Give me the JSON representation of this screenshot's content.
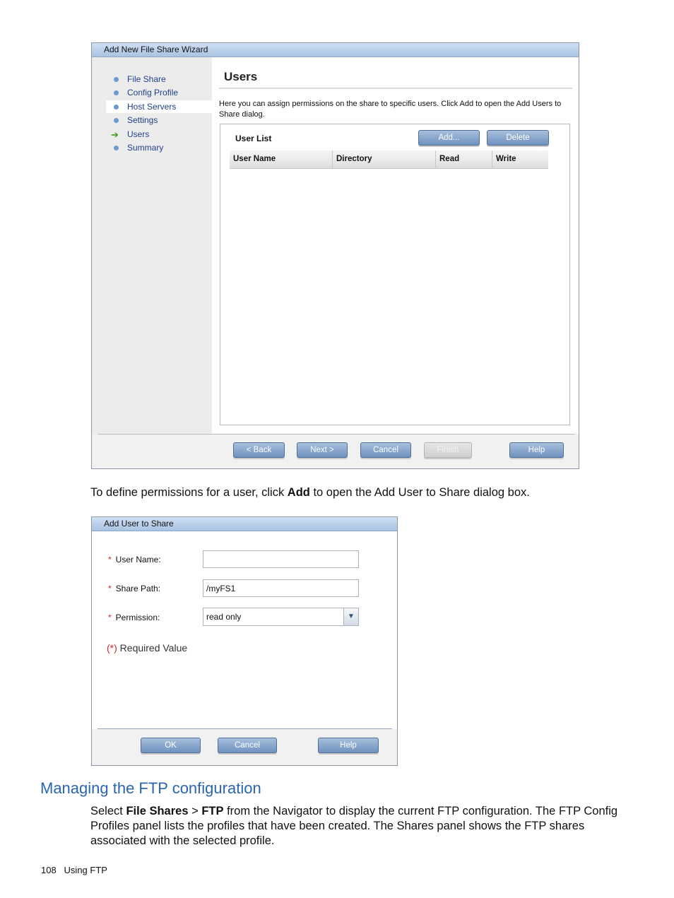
{
  "wizard": {
    "title": "Add New File Share Wizard",
    "nav": [
      {
        "label": "File Share"
      },
      {
        "label": "Config Profile"
      },
      {
        "label": "Host Servers"
      },
      {
        "label": "Settings"
      },
      {
        "label": "Users"
      },
      {
        "label": "Summary"
      }
    ],
    "page_title": "Users",
    "intro": "Here you can assign permissions on the share to specific users. Click Add to open the Add Users to Share dialog.",
    "user_list_label": "User List",
    "add_label": "Add...",
    "delete_label": "Delete",
    "columns": [
      "User Name",
      "Directory",
      "Read",
      "Write"
    ],
    "buttons": {
      "back": "< Back",
      "next": "Next >",
      "cancel": "Cancel",
      "finish": "Finish",
      "help": "Help"
    }
  },
  "para1": {
    "before": "To define permissions for a user, click ",
    "bold": "Add",
    "after": " to open the Add User to Share dialog box."
  },
  "dialog": {
    "title": "Add User to Share",
    "required_mark": "*",
    "user_name_label": "User Name:",
    "user_name_value": "",
    "share_path_label": "Share Path:",
    "share_path_value": "/myFS1",
    "permission_label": "Permission:",
    "permission_value": "read only",
    "required_note_mark": "(*)",
    "required_note_text": " Required Value",
    "buttons": {
      "ok": "OK",
      "cancel": "Cancel",
      "help": "Help"
    }
  },
  "section": {
    "heading": "Managing the FTP configuration",
    "p_select": "Select ",
    "p_file_shares": "File Shares",
    "p_gt": " > ",
    "p_ftp": "FTP",
    "p_rest": " from the Navigator to display the current FTP configuration. The FTP Config Profiles panel lists the profiles that have been created. The Shares panel shows the FTP shares associated with the selected profile."
  },
  "footer": {
    "page_number": "108",
    "chapter": "Using FTP"
  }
}
